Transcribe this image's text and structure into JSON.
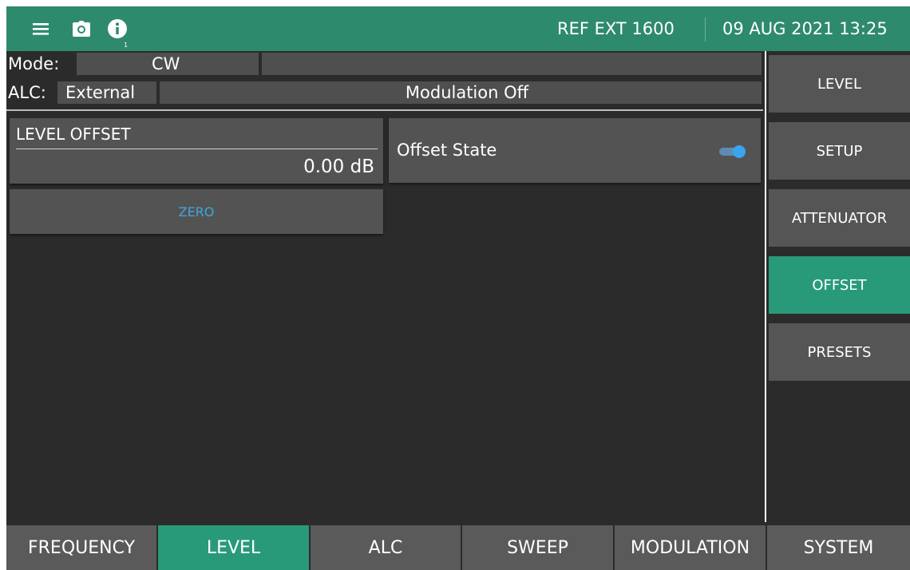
{
  "topbar": {
    "menu_icon": "hamburger-menu-icon",
    "camera_icon": "camera-icon",
    "info_icon": "info-icon",
    "info_badge": "1",
    "reference": "REF EXT 1600",
    "datetime": "09 AUG 2021 13:25"
  },
  "status": {
    "mode_label": "Mode:",
    "mode_value": "CW",
    "mode_extra": "",
    "alc_label": "ALC:",
    "alc_value": "External",
    "modulation": "Modulation Off"
  },
  "content": {
    "level_offset": {
      "title": "LEVEL OFFSET",
      "value": "0.00 dB"
    },
    "offset_state": {
      "label": "Offset State",
      "enabled": true
    },
    "zero_button": "ZERO"
  },
  "right_menu": {
    "items": [
      {
        "label": "LEVEL",
        "active": false
      },
      {
        "label": "SETUP",
        "active": false
      },
      {
        "label": "ATTENUATOR",
        "active": false
      },
      {
        "label": "OFFSET",
        "active": true
      },
      {
        "label": "PRESETS",
        "active": false
      }
    ]
  },
  "bottom_tabs": {
    "items": [
      {
        "label": "FREQUENCY",
        "active": false
      },
      {
        "label": "LEVEL",
        "active": true
      },
      {
        "label": "ALC",
        "active": false
      },
      {
        "label": "SWEEP",
        "active": false
      },
      {
        "label": "MODULATION",
        "active": false
      },
      {
        "label": "SYSTEM",
        "active": false
      }
    ]
  },
  "colors": {
    "accent_green": "#289a7a",
    "topbar_green": "#2e8a6d",
    "background": "#2b2b2b",
    "panel": "#535353",
    "zero_text": "#40a6e0",
    "toggle_on": "#3aa4ee"
  }
}
